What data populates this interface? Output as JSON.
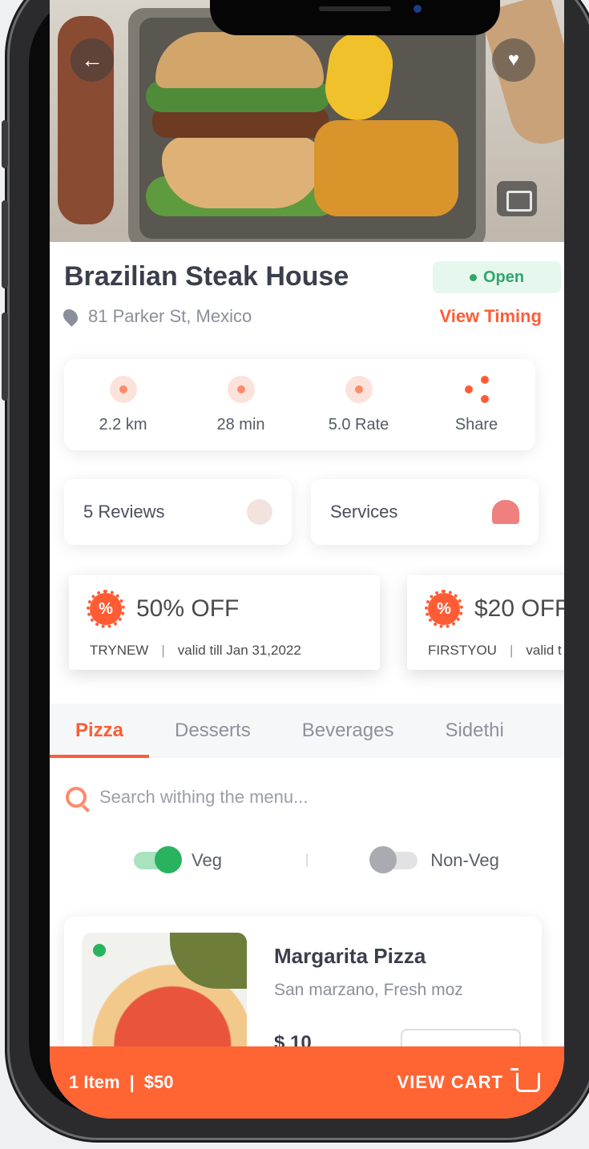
{
  "restaurant": {
    "name": "Brazilian Steak House",
    "status": "Open",
    "address": "81 Parker St, Mexico",
    "timing_link": "View Timing"
  },
  "stats": [
    {
      "label": "2.2 km",
      "icon": "location-icon"
    },
    {
      "label": "28 min",
      "icon": "clock-icon"
    },
    {
      "label": "5.0 Rate",
      "icon": "star-icon"
    },
    {
      "label": "Share",
      "icon": "share-icon"
    }
  ],
  "pills": [
    {
      "label": "5 Reviews",
      "icon": "review-icon"
    },
    {
      "label": "Services",
      "icon": "cake-icon"
    }
  ],
  "offers": [
    {
      "title": "50% OFF",
      "code": "TRYNEW",
      "separator": "|",
      "validity": "valid till Jan 31,2022"
    },
    {
      "title": "$20 OFF",
      "code": "FIRSTYOU",
      "separator": "|",
      "validity": "valid t"
    }
  ],
  "tabs": [
    {
      "label": "Pizza",
      "active": true
    },
    {
      "label": "Desserts",
      "active": false
    },
    {
      "label": "Beverages",
      "active": false
    },
    {
      "label": "Sidethi",
      "active": false
    }
  ],
  "search": {
    "placeholder": "Search withing the menu..."
  },
  "filters": {
    "veg_label": "Veg",
    "nonveg_label": "Non-Veg"
  },
  "menu_item": {
    "name": "Margarita Pizza",
    "description": "San marzano, Fresh moz",
    "price": "$ 10"
  },
  "cart": {
    "items": "1 Item",
    "separator": "|",
    "total": "$50",
    "action": "VIEW CART"
  },
  "colors": {
    "accent": "#ff6433",
    "open_green": "#2ea86b"
  }
}
